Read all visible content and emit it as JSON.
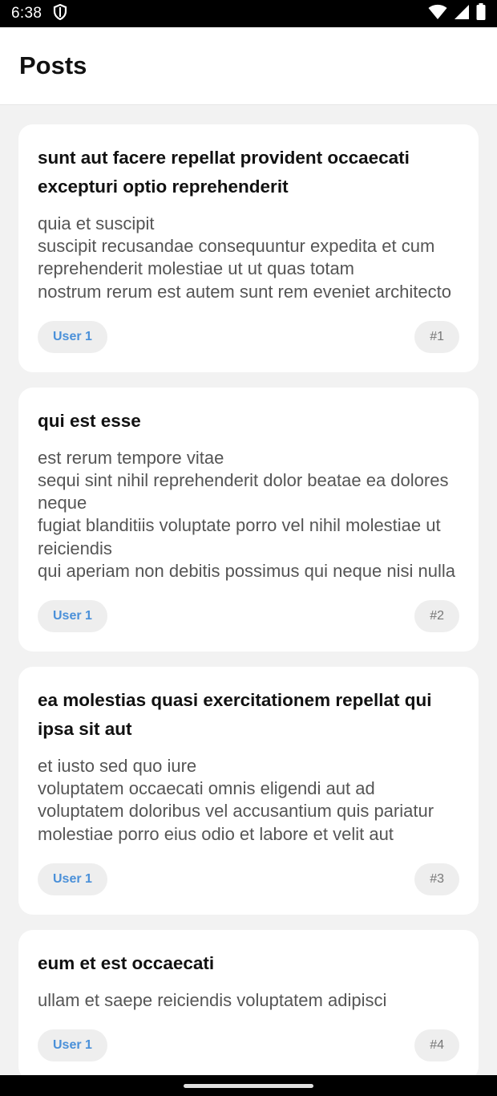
{
  "status_bar": {
    "time": "6:38",
    "icons": [
      "shield-icon",
      "wifi-icon",
      "signal-icon",
      "battery-icon"
    ]
  },
  "app_bar": {
    "title": "Posts"
  },
  "posts": [
    {
      "title": "sunt aut facere repellat provident occaecati excepturi optio reprehenderit",
      "body": "quia et suscipit\nsuscipit recusandae consequuntur expedita et cum\nreprehenderit molestiae ut ut quas totam\nnostrum rerum est autem sunt rem eveniet architecto",
      "user": "User 1",
      "id": "#1"
    },
    {
      "title": "qui est esse",
      "body": "est rerum tempore vitae\nsequi sint nihil reprehenderit dolor beatae ea dolores neque\nfugiat blanditiis voluptate porro vel nihil molestiae ut reiciendis\nqui aperiam non debitis possimus qui neque nisi nulla",
      "user": "User 1",
      "id": "#2"
    },
    {
      "title": "ea molestias quasi exercitationem repellat qui ipsa sit aut",
      "body": "et iusto sed quo iure\nvoluptatem occaecati omnis eligendi aut ad\nvoluptatem doloribus vel accusantium quis pariatur\nmolestiae porro eius odio et labore et velit aut",
      "user": "User 1",
      "id": "#3"
    },
    {
      "title": "eum et est occaecati",
      "body": "ullam et saepe reiciendis voluptatem adipisci",
      "user": "User 1",
      "id": "#4"
    }
  ],
  "colors": {
    "accent": "#4a90d9",
    "background": "#f2f2f2",
    "card": "#ffffff"
  }
}
